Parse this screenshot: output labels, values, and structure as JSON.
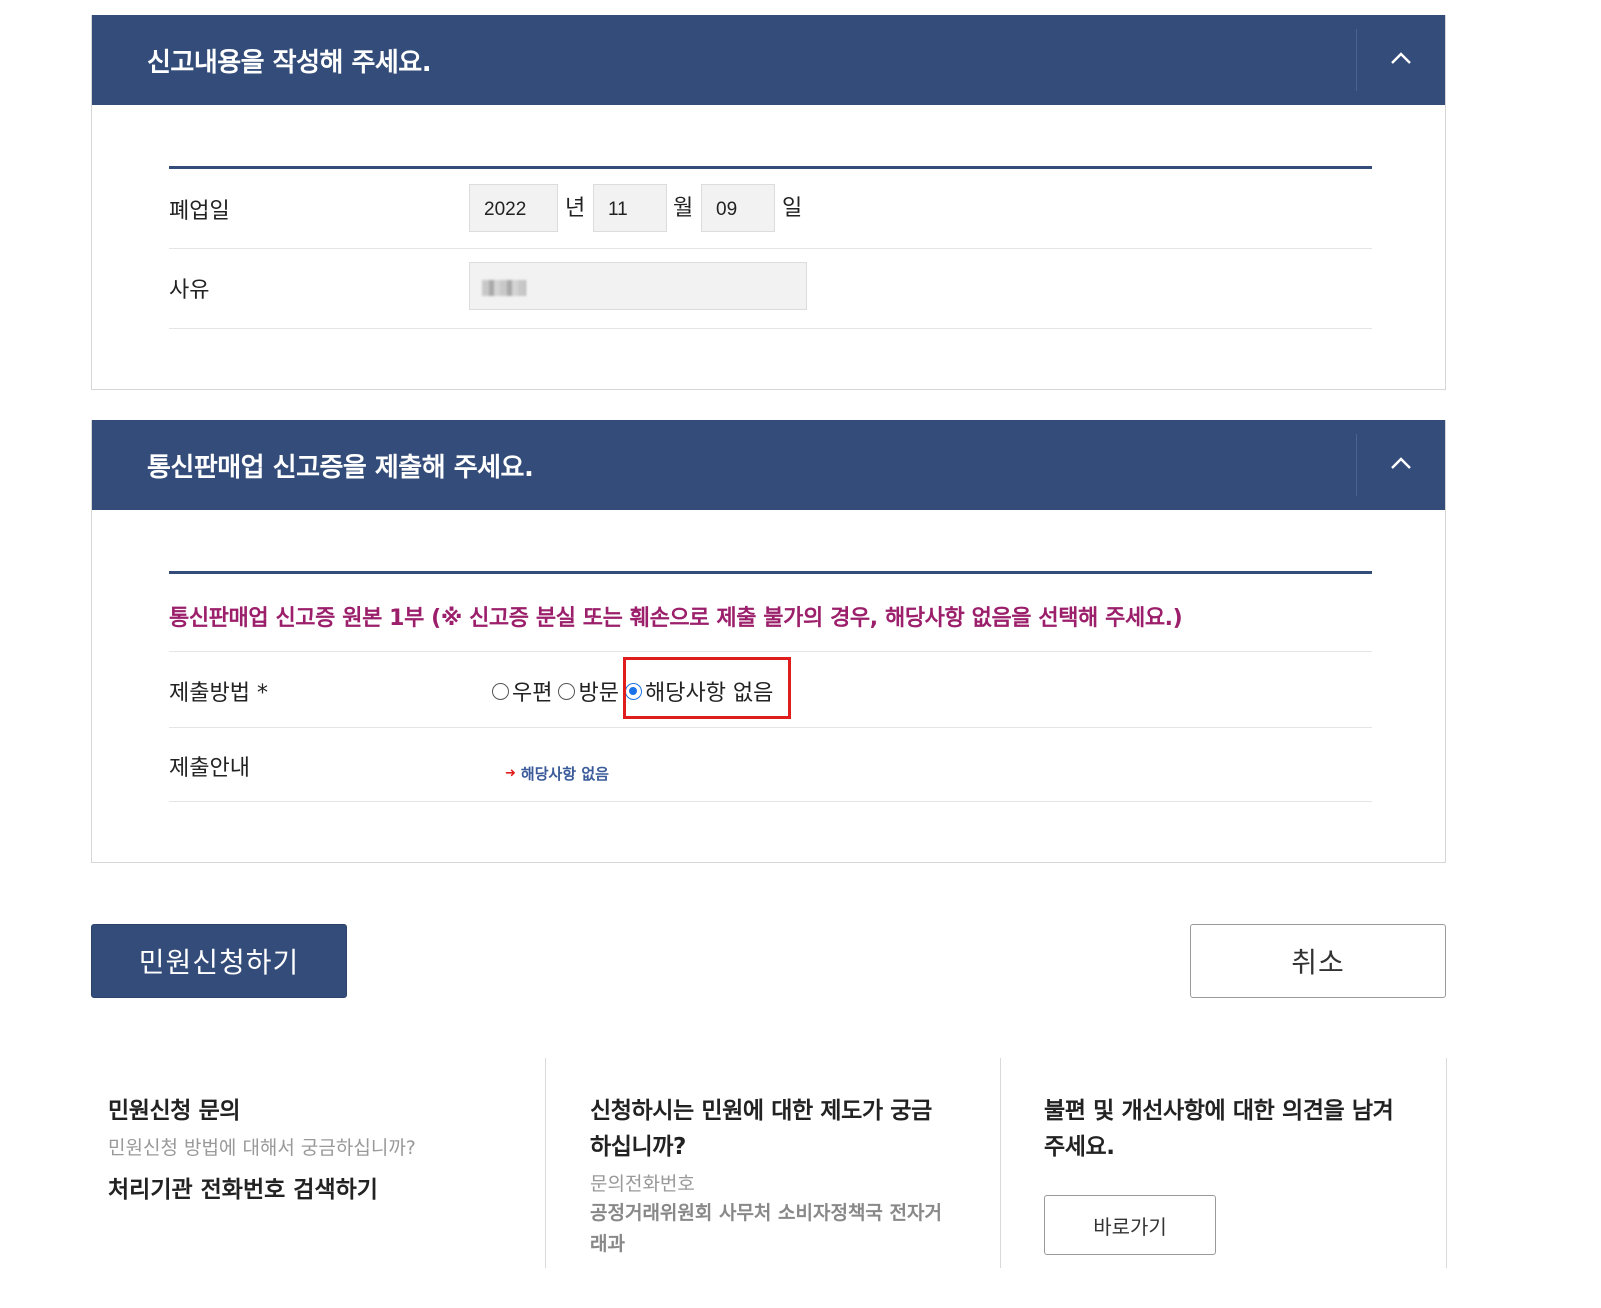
{
  "section_report": {
    "title": "신고내용을 작성해 주세요.",
    "fields": {
      "closure_label": "폐업일",
      "year": "2022",
      "year_unit": "년",
      "month": "11",
      "month_unit": "월",
      "day": "09",
      "day_unit": "일",
      "reason_label": "사유"
    }
  },
  "section_submit": {
    "title": "통신판매업 신고증을 제출해 주세요.",
    "notice": "통신판매업 신고증 원본 1부 (※ 신고증 분실 또는 훼손으로 제출 불가의 경우, 해당사항 없음을 선택해 주세요.)",
    "method_label": "제출방법 *",
    "method_options": [
      "우편",
      "방문",
      "해당사항 없음"
    ],
    "method_selected": "해당사항 없음",
    "guide_label": "제출안내",
    "guide_text": "해당사항 없음"
  },
  "actions": {
    "submit": "민원신청하기",
    "cancel": "취소"
  },
  "info": {
    "col1": {
      "title": "민원신청 문의",
      "subtitle": "민원신청 방법에 대해서 궁금하십니까?",
      "link": "처리기관 전화번호 검색하기"
    },
    "col2": {
      "title": "신청하시는 민원에 대한 제도가 궁금하십니까?",
      "phone_label": "문의전화번호",
      "dept": "공정거래위원회 사무처 소비자정책국 전자거래과"
    },
    "col3": {
      "title": "불편 및 개선사항에 대한 의견을 남겨주세요.",
      "button": "바로가기"
    }
  },
  "colors": {
    "header_bg": "#344c79",
    "notice_text": "#9b1f6a",
    "highlight_border": "#e01d1d"
  },
  "icons": [
    "chevron-up-icon",
    "arrow-right-icon"
  ]
}
